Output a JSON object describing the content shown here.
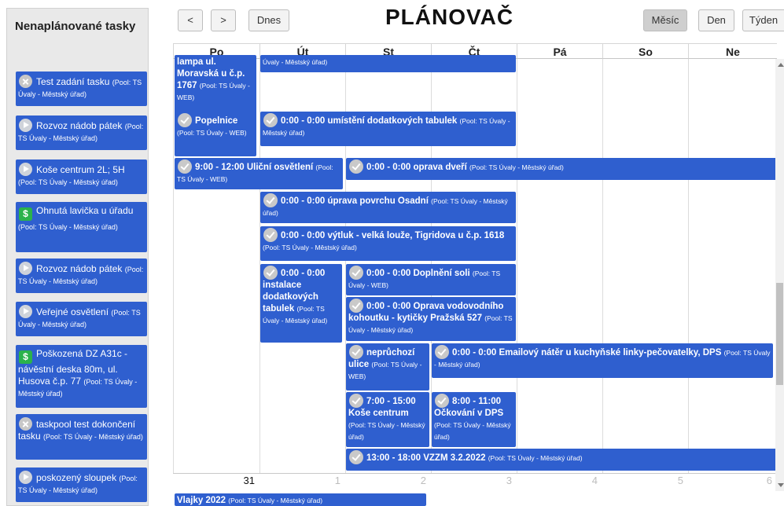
{
  "sidebar": {
    "title": "Nenaplánované tasky",
    "tasks": [
      {
        "icon": "close-circle-icon",
        "title": "Test zadání tasku",
        "pool": "(Pool: TS Úvaly - Městský úřad)"
      },
      {
        "icon": "play-circle-icon",
        "title": "Rozvoz nádob pátek",
        "pool": "(Pool: TS Úvaly - Městský úřad)"
      },
      {
        "icon": "play-circle-icon",
        "title": "Koše centrum 2L; 5H",
        "pool": "(Pool: TS Úvaly - Městský úřad)"
      },
      {
        "icon": "dollar-icon",
        "title": "Ohnutá lavička u úřadu",
        "pool": "(Pool: TS Úvaly - Městský úřad)"
      },
      {
        "icon": "play-circle-icon",
        "title": "Rozvoz nádob pátek",
        "pool": "(Pool: TS Úvaly - Městský úřad)"
      },
      {
        "icon": "play-circle-icon",
        "title": "Veřejné osvětlení",
        "pool": "(Pool: TS Úvaly - Městský úřad)"
      },
      {
        "icon": "dollar-icon",
        "title": "Poškozená DZ A31c - návěstní deska 80m, ul. Husova č.p. 77",
        "pool": "(Pool: TS Úvaly - Městský úřad)"
      },
      {
        "icon": "close-circle-icon",
        "title": "taskpool test dokončení tasku",
        "pool": "(Pool: TS Úvaly - Městský úřad)"
      },
      {
        "icon": "play-circle-icon",
        "title": "poskozený sloupek",
        "pool": "(Pool: TS Úvaly - Městský úřad)"
      }
    ]
  },
  "toolbar": {
    "prev": "<",
    "next": ">",
    "today": "Dnes",
    "title": "PLÁNOVAČ",
    "views": [
      "Měsíc",
      "Den",
      "Týden"
    ],
    "active_view": "Měsíc"
  },
  "calendar": {
    "weekdays": [
      "Po",
      "Út",
      "St",
      "Čt",
      "Pá",
      "So",
      "Ne"
    ],
    "day_numbers": [
      "31",
      "1",
      "2",
      "3",
      "4",
      "5",
      "6"
    ],
    "events": [
      {
        "title": "lampa ul. Moravská u č.p. 1767",
        "pool": "(Pool: TS Úvaly - WEB)",
        "check": false
      },
      {
        "title": "",
        "pool": "Úvaly - Městský úřad)",
        "check": false
      },
      {
        "title": "Popelnice",
        "pool": "(Pool: TS Úvaly - WEB)",
        "check": true
      },
      {
        "title": "0:00 - 0:00 umístění dodatkových tabulek",
        "pool": "(Pool: TS Úvaly - Městský úřad)",
        "check": true
      },
      {
        "title": "9:00 - 12:00 Uliční osvětlení",
        "pool": "(Pool: TS Úvaly - WEB)",
        "check": true
      },
      {
        "title": "0:00 - 0:00 oprava dveří",
        "pool": "(Pool: TS Úvaly - Městský úřad)",
        "check": true
      },
      {
        "title": "0:00 - 0:00 úprava povrchu Osadní",
        "pool": "(Pool: TS Úvaly - Městský úřad)",
        "check": true
      },
      {
        "title": "0:00 - 0:00 výtluk - velká louže, Tigridova u č.p. 1618",
        "pool": "(Pool: TS Úvaly - Městský úřad)",
        "check": true
      },
      {
        "title": "0:00 - 0:00 instalace dodatkových tabulek",
        "pool": "(Pool: TS Úvaly - Městský úřad)",
        "check": true
      },
      {
        "title": "0:00 - 0:00 Doplnění soli",
        "pool": "(Pool: TS Úvaly - WEB)",
        "check": true
      },
      {
        "title": "0:00 - 0:00 Oprava vodovodního kohoutku - kytičky Pražská 527",
        "pool": "(Pool: TS Úvaly - Městský úřad)",
        "check": true
      },
      {
        "title": "neprůchozí ulice",
        "pool": "(Pool: TS Úvaly - WEB)",
        "check": true
      },
      {
        "title": "0:00 - 0:00 Emailový nátěr u kuchyňské linky-pečovatelky, DPS",
        "pool": "(Pool: TS Úvaly - Městský úřad)",
        "check": true
      },
      {
        "title": "7:00 - 15:00 Koše centrum",
        "pool": "(Pool: TS Úvaly - Městský úřad)",
        "check": true
      },
      {
        "title": "8:00 - 11:00 Očkování v DPS",
        "pool": "(Pool: TS Úvaly - Městský úřad)",
        "check": true
      },
      {
        "title": "13:00 - 18:00 VZZM 3.2.2022",
        "pool": "(Pool: TS Úvaly - Městský úřad)",
        "check": true
      },
      {
        "title": "Vlajky 2022",
        "pool": "(Pool: TS Úvaly - Městský úřad)",
        "check": false
      }
    ]
  }
}
